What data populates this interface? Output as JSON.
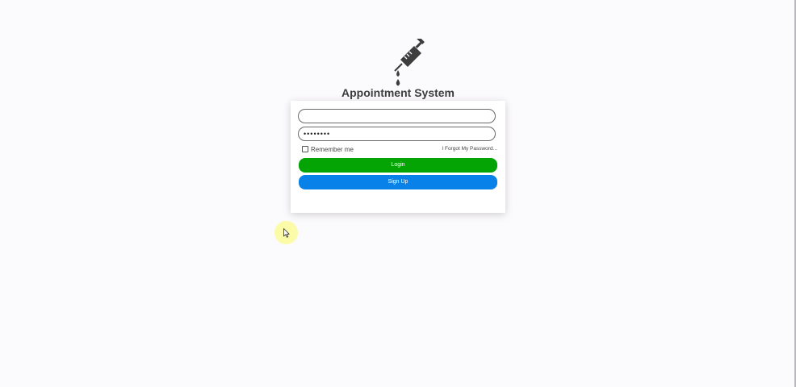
{
  "app": {
    "logo_icon": "syringe-icon",
    "title": "Appointment System"
  },
  "login_form": {
    "username_value": "",
    "password_value": "••••••••",
    "remember_label": "Remember me",
    "remember_checked": false,
    "forgot_label": "I Forgot My Password...",
    "login_label": "Login",
    "signup_label": "Sign Up"
  },
  "colors": {
    "login_button": "#04a404",
    "signup_button": "#0881e8",
    "background": "#fbfafc"
  },
  "pointer": {
    "icon": "mouse-pointer-icon"
  }
}
